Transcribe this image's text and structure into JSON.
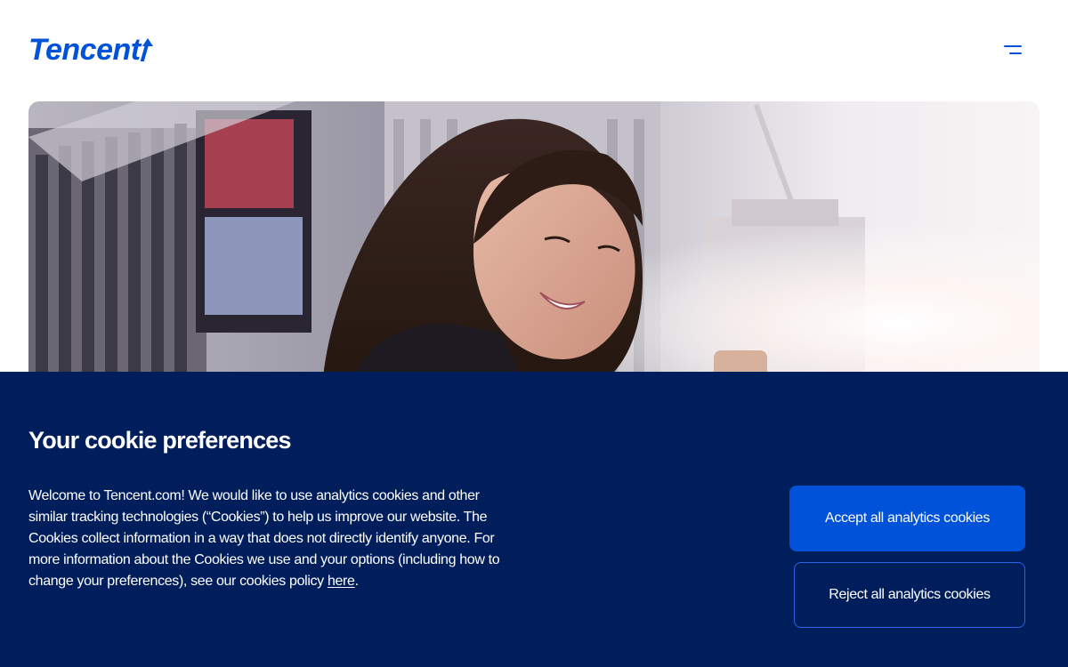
{
  "colors": {
    "brand_blue": "#0052d9",
    "banner_bg": "#001e5c",
    "accept_bg": "#0052d9",
    "reject_border": "#2a63e6",
    "text_on_dark": "#ffffff"
  },
  "header": {
    "logo_text": "Tencent",
    "logo_icon": "tencent-arrow-icon",
    "menu_icon": "menu-icon"
  },
  "hero": {
    "image": "smiling-woman-city-photo"
  },
  "cookie_banner": {
    "title": "Your cookie preferences",
    "body_text": "Welcome to Tencent.com! We would like to use analytics cookies and other similar tracking technologies (“Cookies”) to help us improve our website. The Cookies collect information in a way that does not directly identify anyone. For more information about the Cookies we use and your options (including how to change your preferences), see our cookies policy",
    "link_text": "here",
    "trailing_text": ".",
    "accept_label": "Accept all analytics cookies",
    "reject_label": "Reject all analytics cookies"
  }
}
